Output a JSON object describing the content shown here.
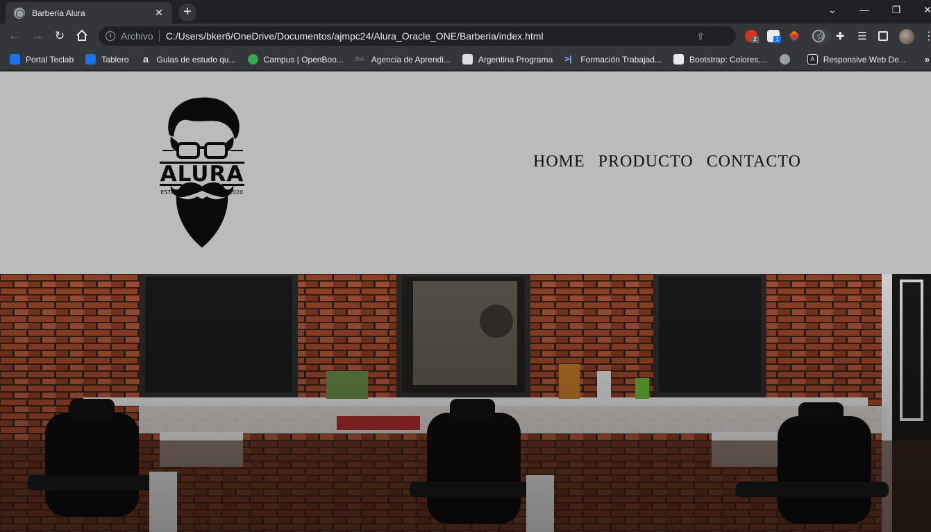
{
  "browser": {
    "tab_title": "Barbería Alura",
    "omnibox": {
      "scheme_label": "Archivo",
      "url": "C:/Users/bker6/OneDrive/Documentos/ajmpc24/Alura_Oracle_ONE/Barberia/index.html"
    },
    "extension_badges": [
      "2",
      "1"
    ],
    "bookmarks": [
      {
        "label": "Portal Teclab",
        "icon_color": "#1a73e8",
        "icon": "play-icon"
      },
      {
        "label": "Tablero",
        "icon_color": "#1a73e8",
        "icon": "play-icon"
      },
      {
        "label": "Guias de estudo qu...",
        "icon_color": "#35363a",
        "icon": "amazon-icon"
      },
      {
        "label": "Campus | OpenBoo...",
        "icon_color": "#34a853",
        "icon": "chat-icon"
      },
      {
        "label": "Agencia de Aprendi...",
        "icon_color": "#5f6368",
        "icon": "ba-icon"
      },
      {
        "label": "Argentina Programa",
        "icon_color": "#dadce0",
        "icon": "terminal-icon"
      },
      {
        "label": "Formación Trabajad...",
        "icon_color": "#1a73e8",
        "icon": "brackets-icon"
      },
      {
        "label": "Bootstrap: Colores,...",
        "icon_color": "#e8eaed",
        "icon": "alura-icon"
      },
      {
        "label": "",
        "icon_color": "#9aa0a6",
        "icon": "globe-icon"
      },
      {
        "label": "Responsive Web De...",
        "icon_color": "#202124",
        "icon": "a-icon"
      }
    ],
    "bookmarks_more": "»"
  },
  "page": {
    "logo": {
      "brand": "ALURA",
      "left_text": "ESTD",
      "right_text": "2020"
    },
    "nav": [
      "HOME",
      "PRODUCTO",
      "CONTACTO"
    ],
    "hero_description": "barbershop-interior-photo"
  },
  "colors": {
    "header_bg": "#bbbbbb",
    "nav_text": "#111111",
    "chrome_dark": "#202124",
    "chrome_toolbar": "#35363a"
  }
}
